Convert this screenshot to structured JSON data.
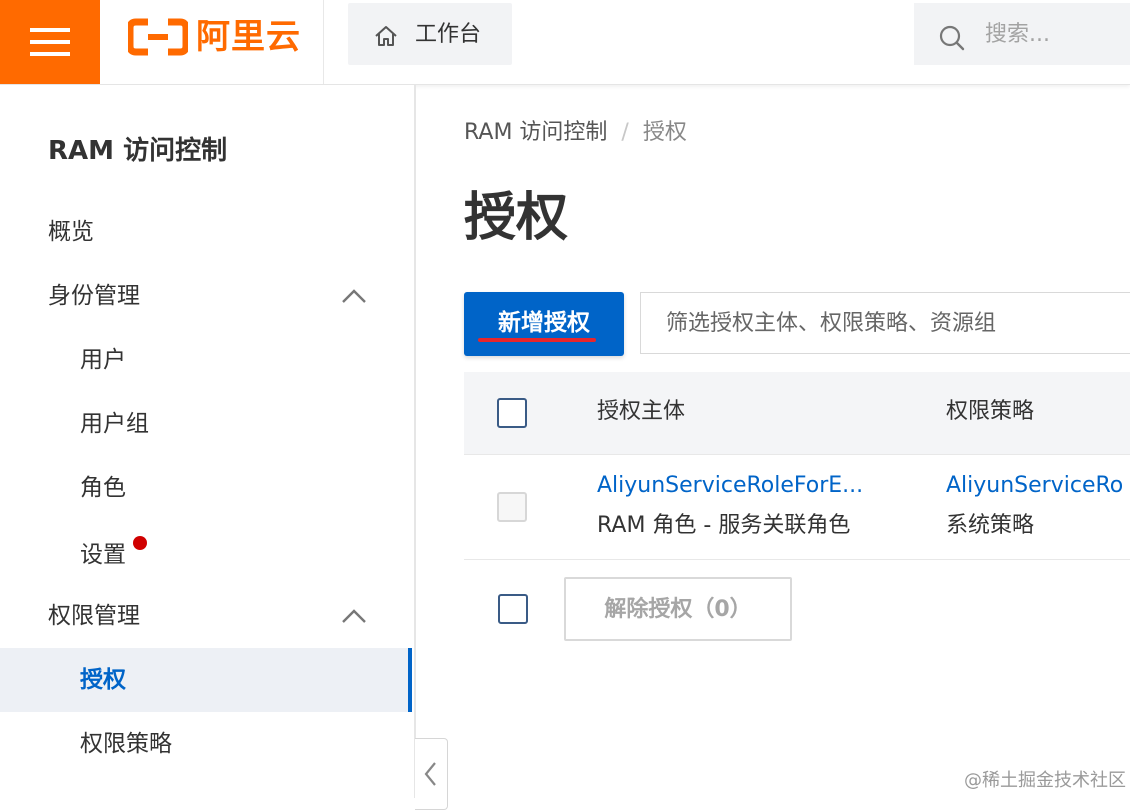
{
  "header": {
    "logo_text": "阿里云",
    "workbench_label": "工作台",
    "search_placeholder": "搜索..."
  },
  "sidebar": {
    "title": "RAM 访问控制",
    "items": [
      {
        "label": "概览"
      },
      {
        "label": "身份管理",
        "expanded": true
      },
      {
        "label": "用户"
      },
      {
        "label": "用户组"
      },
      {
        "label": "角色"
      },
      {
        "label": "设置",
        "badge": "red-dot"
      },
      {
        "label": "权限管理",
        "expanded": true
      },
      {
        "label": "授权",
        "active": true
      },
      {
        "label": "权限策略"
      }
    ]
  },
  "breadcrumb": {
    "items": [
      "RAM 访问控制",
      "授权"
    ],
    "separator": "/"
  },
  "page": {
    "title": "授权",
    "add_button_label": "新增授权",
    "filter_placeholder": "筛选授权主体、权限策略、资源组"
  },
  "table": {
    "columns": [
      "授权主体",
      "权限策略"
    ],
    "rows": [
      {
        "principal": "AliyunServiceRoleForE...",
        "principal_type": "RAM 角色 - 服务关联角色",
        "policy": "AliyunServiceRo",
        "policy_type": "系统策略"
      }
    ]
  },
  "footer": {
    "remove_button_label": "解除授权（0）"
  },
  "watermark": "@稀土掘金技术社区",
  "colors": {
    "brand_orange": "#ff6a00",
    "primary_blue": "#0064c8",
    "annotation_red": "#e6262c"
  }
}
